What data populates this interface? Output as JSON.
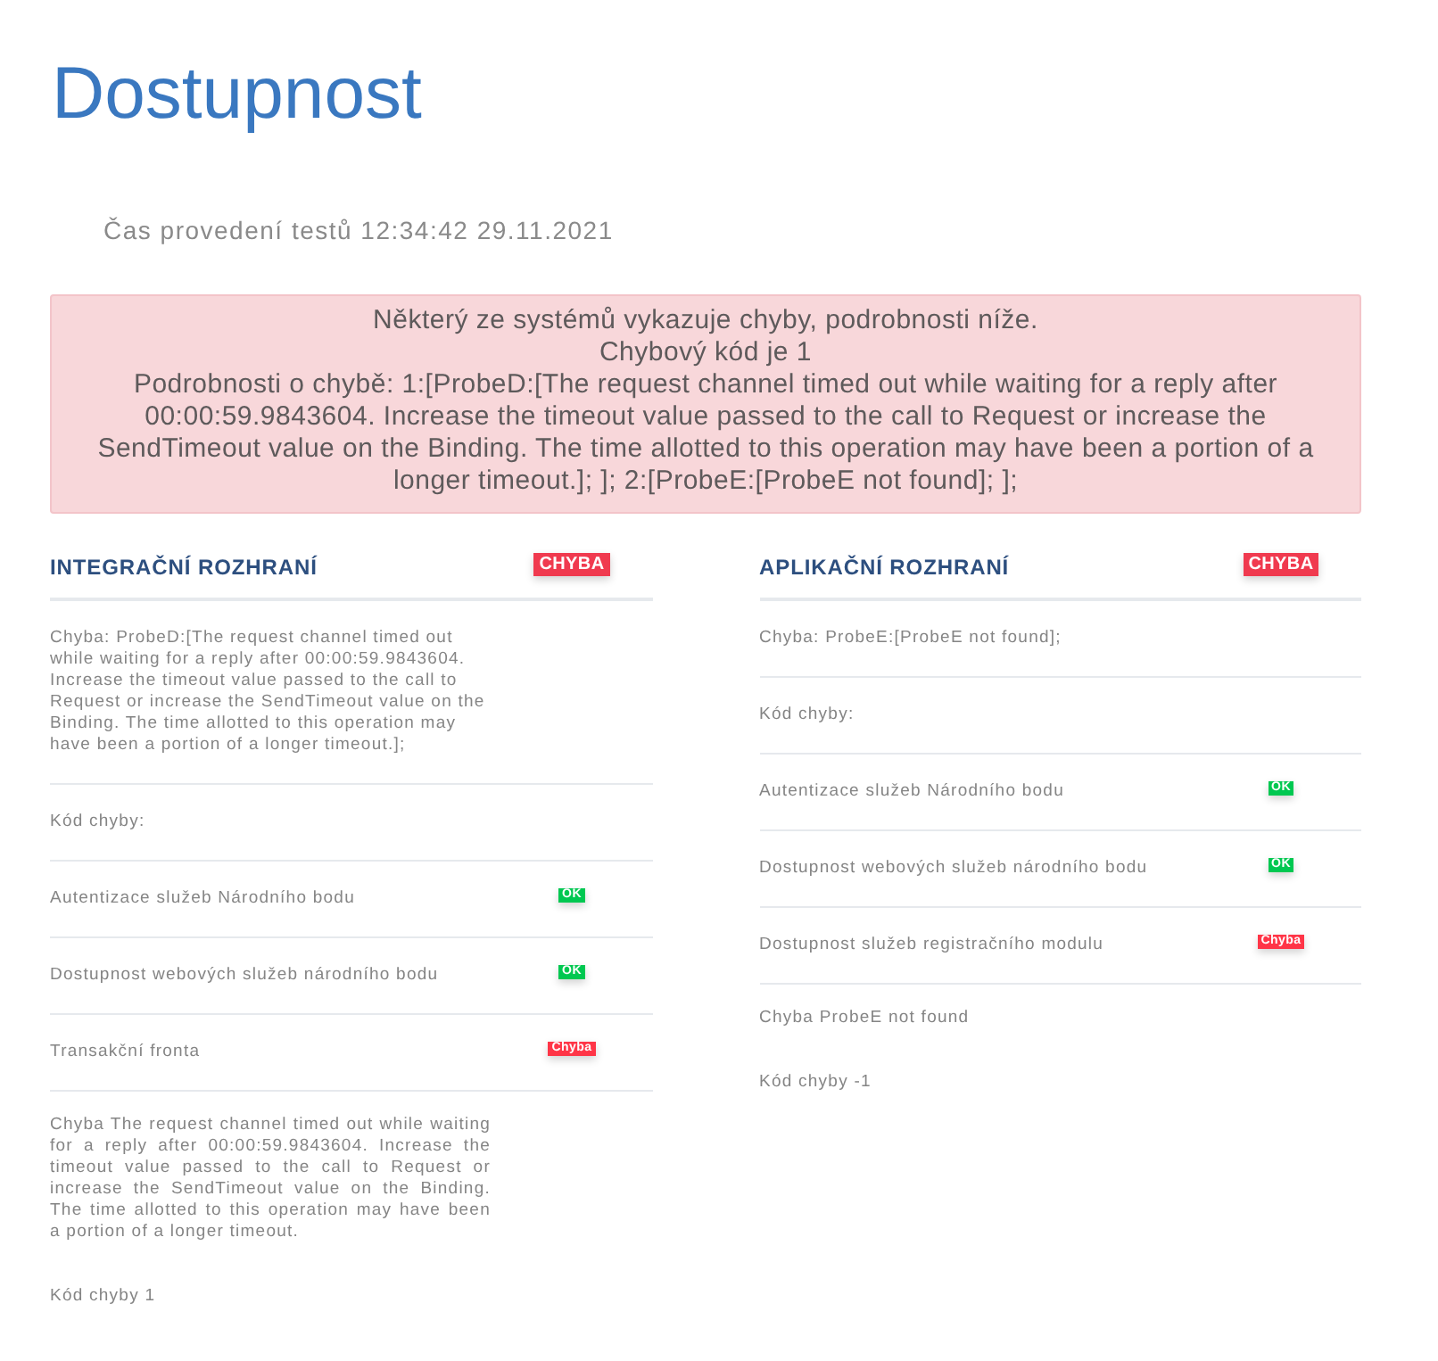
{
  "page": {
    "title": "Dostupnost",
    "test_time": "Čas provedení testů 12:34:42 29.11.2021"
  },
  "alert": {
    "lines": [
      "Některý ze systémů vykazuje chyby, podrobnosti níže.",
      "Chybový kód je 1",
      "Podrobnosti o chybě: 1:[ProbeD:[The request channel timed out while waiting for a reply after 00:00:59.9843604. Increase the timeout value passed to the call to Request or increase the SendTimeout value on the Binding. The time allotted to this operation may have been a portion of a longer timeout.]; ]; 2:[ProbeE:[ProbeE not found]; ];"
    ]
  },
  "panels": [
    {
      "title": "INTEGRAČNÍ ROZHRANÍ",
      "status": {
        "label": "CHYBA",
        "color": "#f03a4f"
      },
      "rows": [
        {
          "kind": "text",
          "text": "Chyba: ProbeD:[The request channel timed out while waiting for a reply after 00:00:59.9843604. Increase the timeout value passed to the call to Request or increase the SendTimeout value on the Binding. The time allotted to this operation may have been a portion of a longer timeout.];"
        },
        {
          "kind": "text",
          "text": "Kód chyby:"
        },
        {
          "kind": "check",
          "label": "Autentizace služeb Národního bodu",
          "status": {
            "label": "OK",
            "color": "#00c851"
          }
        },
        {
          "kind": "check",
          "label": "Dostupnost webových služeb národního bodu",
          "status": {
            "label": "OK",
            "color": "#00c851"
          }
        },
        {
          "kind": "check",
          "label": "Transakční fronta",
          "status": {
            "label": "Chyba",
            "color": "#ff3547"
          }
        },
        {
          "kind": "note",
          "text": "Chyba The request channel timed out while waiting for a reply after 00:00:59.9843604. Increase the timeout value passed to the call to Request or increase the SendTimeout value on the Binding. The time allotted to this operation may have been a portion of a longer timeout."
        },
        {
          "kind": "note",
          "text": "Kód chyby 1"
        }
      ]
    },
    {
      "title": "APLIKAČNÍ ROZHRANÍ",
      "status": {
        "label": "CHYBA",
        "color": "#f03a4f"
      },
      "rows": [
        {
          "kind": "text",
          "text": "Chyba: ProbeE:[ProbeE not found];"
        },
        {
          "kind": "text",
          "text": "Kód chyby:"
        },
        {
          "kind": "check",
          "label": "Autentizace služeb Národního bodu",
          "status": {
            "label": "OK",
            "color": "#00c851"
          }
        },
        {
          "kind": "check",
          "label": "Dostupnost webových služeb národního bodu",
          "status": {
            "label": "OK",
            "color": "#00c851"
          }
        },
        {
          "kind": "check",
          "label": "Dostupnost služeb registračního modulu",
          "status": {
            "label": "Chyba",
            "color": "#ff3547"
          }
        },
        {
          "kind": "note",
          "text": "Chyba ProbeE not found"
        },
        {
          "kind": "note",
          "text": "Kód chyby -1"
        }
      ]
    }
  ]
}
